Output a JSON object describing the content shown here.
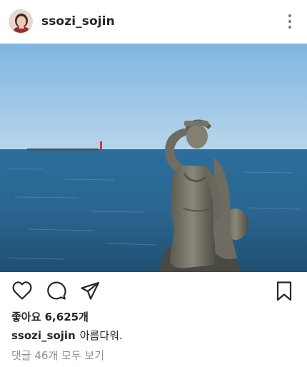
{
  "post": {
    "username": "ssozi_sojin",
    "likes_text": "좋아요 6,625개",
    "caption_user": "ssozi_sojin",
    "caption_text": "아름다워.",
    "comments_link": "댓글 46개 모두 보기"
  },
  "icons": {
    "more": "more-options-icon",
    "like": "heart-icon",
    "comment": "comment-icon",
    "share": "send-icon",
    "save": "bookmark-icon"
  },
  "colors": {
    "text": "#262626",
    "muted": "#8e8e8e",
    "sky": "#8ec0e6",
    "sea": "#2f6f9b"
  }
}
